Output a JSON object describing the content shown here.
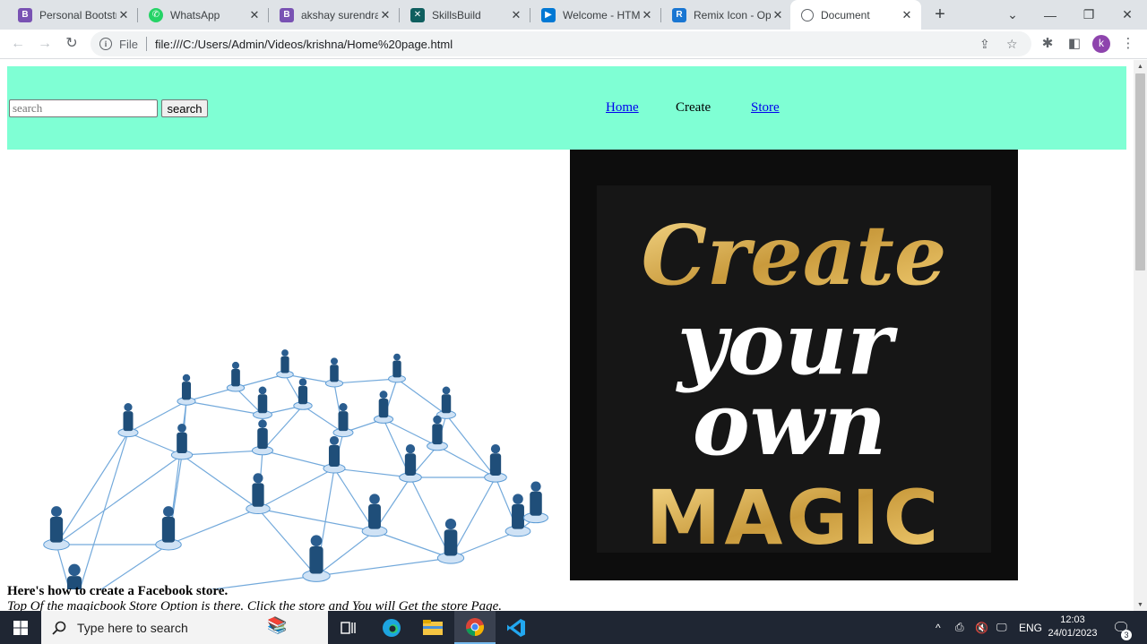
{
  "browser": {
    "tabs": [
      {
        "title": "Personal Bootstra",
        "favicon": "B",
        "favicon_color": "#7952b3"
      },
      {
        "title": "WhatsApp",
        "favicon": "whatsapp",
        "favicon_color": "#25d366"
      },
      {
        "title": "akshay surendran",
        "favicon": "B",
        "favicon_color": "#7952b3"
      },
      {
        "title": "SkillsBuild",
        "favicon": "SB",
        "favicon_color": "#0f5f5f"
      },
      {
        "title": "Welcome - HTML",
        "favicon": "play",
        "favicon_color": "#0078d4"
      },
      {
        "title": "Remix Icon - Ope",
        "favicon": "remix",
        "favicon_color": "#1976d2"
      },
      {
        "title": "Document",
        "favicon": "globe",
        "favicon_color": "#5f6368",
        "active": true
      }
    ],
    "new_tab": "+",
    "address": {
      "scheme": "File",
      "url": "file:///C:/Users/Admin/Videos/krishna/Home%20page.html"
    },
    "profile_initial": "k"
  },
  "page": {
    "header_bg": "#7fffd4",
    "search": {
      "placeholder": "search",
      "button": "search"
    },
    "nav": {
      "home": "Home",
      "create": "Create",
      "store": "Store"
    },
    "magic_image": {
      "line1": "Create",
      "line2": "your",
      "line3": "own",
      "line4": "MAGIC"
    },
    "heading": "Here's how to create a Facebook store.",
    "subtext": "Top Of the magicbook Store Option is there. Click the store and You will Get the store Page."
  },
  "taskbar": {
    "search_placeholder": "Type here to search",
    "language": "ENG",
    "time": "12:03",
    "date": "24/01/2023",
    "notification_count": "3"
  }
}
